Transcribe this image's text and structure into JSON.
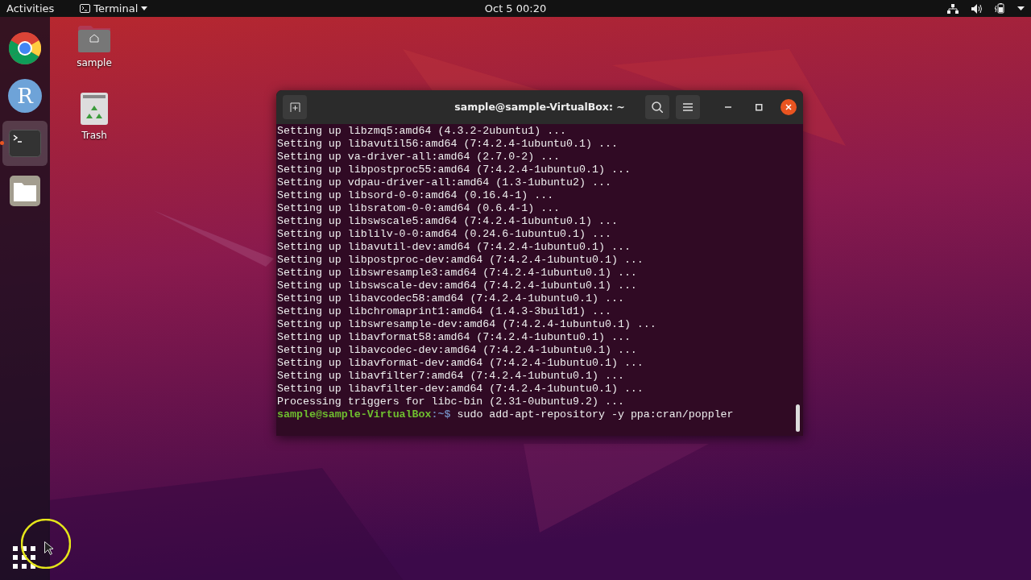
{
  "top_bar": {
    "activities": "Activities",
    "app_menu": "Terminal",
    "clock": "Oct 5  00:20"
  },
  "dock": [
    {
      "kind": "browser",
      "running": false,
      "selected": false
    },
    {
      "kind": "r",
      "letter": "R",
      "running": false,
      "selected": false
    },
    {
      "kind": "terminal",
      "running": true,
      "selected": true
    },
    {
      "kind": "files",
      "running": false,
      "selected": false
    }
  ],
  "desktop_icons": [
    {
      "kind": "home",
      "label": "sample"
    },
    {
      "kind": "trash",
      "label": "Trash"
    }
  ],
  "terminal": {
    "title": "sample@sample-VirtualBox: ~",
    "lines": [
      "Setting up libzmq5:amd64 (4.3.2-2ubuntu1) ...",
      "Setting up libavutil56:amd64 (7:4.2.4-1ubuntu0.1) ...",
      "Setting up va-driver-all:amd64 (2.7.0-2) ...",
      "Setting up libpostproc55:amd64 (7:4.2.4-1ubuntu0.1) ...",
      "Setting up vdpau-driver-all:amd64 (1.3-1ubuntu2) ...",
      "Setting up libsord-0-0:amd64 (0.16.4-1) ...",
      "Setting up libsratom-0-0:amd64 (0.6.4-1) ...",
      "Setting up libswscale5:amd64 (7:4.2.4-1ubuntu0.1) ...",
      "Setting up liblilv-0-0:amd64 (0.24.6-1ubuntu0.1) ...",
      "Setting up libavutil-dev:amd64 (7:4.2.4-1ubuntu0.1) ...",
      "Setting up libpostproc-dev:amd64 (7:4.2.4-1ubuntu0.1) ...",
      "Setting up libswresample3:amd64 (7:4.2.4-1ubuntu0.1) ...",
      "Setting up libswscale-dev:amd64 (7:4.2.4-1ubuntu0.1) ...",
      "Setting up libavcodec58:amd64 (7:4.2.4-1ubuntu0.1) ...",
      "Setting up libchromaprint1:amd64 (1.4.3-3build1) ...",
      "Setting up libswresample-dev:amd64 (7:4.2.4-1ubuntu0.1) ...",
      "Setting up libavformat58:amd64 (7:4.2.4-1ubuntu0.1) ...",
      "Setting up libavcodec-dev:amd64 (7:4.2.4-1ubuntu0.1) ...",
      "Setting up libavformat-dev:amd64 (7:4.2.4-1ubuntu0.1) ...",
      "Setting up libavfilter7:amd64 (7:4.2.4-1ubuntu0.1) ...",
      "Setting up libavfilter-dev:amd64 (7:4.2.4-1ubuntu0.1) ...",
      "Processing triggers for libc-bin (2.31-0ubuntu9.2) ..."
    ],
    "prompt": {
      "user_host": "sample@sample-VirtualBox",
      "path": ":~$",
      "command": "sudo add-apt-repository -y ppa:cran/poppler"
    }
  }
}
